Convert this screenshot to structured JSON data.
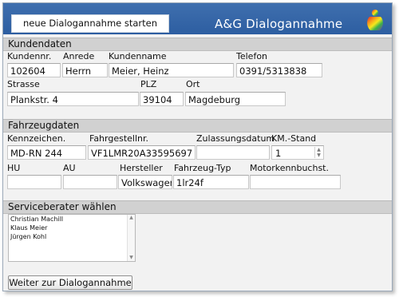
{
  "header": {
    "start_button": "neue Dialogannahme starten",
    "brand": "A&G Dialogannahme",
    "logo_icon": "rainbow-figure-logo",
    "colors": {
      "header_bg": "#2d5ea1",
      "panel_bg": "#f2f2f2",
      "section_bg": "#d1d1d1"
    }
  },
  "kundendaten": {
    "title": "Kundendaten",
    "labels": {
      "kundennr": "Kundennr.",
      "anrede": "Anrede",
      "kundenname": "Kundenname",
      "telefon": "Telefon",
      "strasse": "Strasse",
      "plz": "PLZ",
      "ort": "Ort"
    },
    "values": {
      "kundennr": "102604",
      "anrede": "Herrn",
      "kundenname": "Meier, Heinz",
      "telefon": "0391/5313838",
      "strasse": "Plankstr. 4",
      "plz": "39104",
      "ort": "Magdeburg"
    }
  },
  "fahrzeugdaten": {
    "title": "Fahrzeugdaten",
    "labels": {
      "kennzeichen": "Kennzeichen.",
      "fahrgestellnr": "Fahrgestellnr.",
      "zulassungsdatum": "Zulassungsdatum",
      "km_stand": "KM.-Stand",
      "hu": "HU",
      "au": "AU",
      "hersteller": "Hersteller",
      "fahrzeug_typ": "Fahrzeug-Typ",
      "motorkennbuchst": "Motorkennbuchst."
    },
    "values": {
      "kennzeichen": "MD-RN 244",
      "fahrgestellnr": "VF1LMR20A33595697",
      "zulassungsdatum": "",
      "km_stand": "1",
      "hu": "",
      "au": "",
      "hersteller": "Volkswagen",
      "fahrzeug_typ": "1lr24f",
      "motorkennbuchst": ""
    }
  },
  "serviceberater": {
    "title": "Serviceberater wählen",
    "options": [
      "Christian Machill",
      "Klaus Meier",
      "Jürgen Kohl"
    ]
  },
  "footer": {
    "next_button": "Weiter zur Dialogannahme"
  }
}
